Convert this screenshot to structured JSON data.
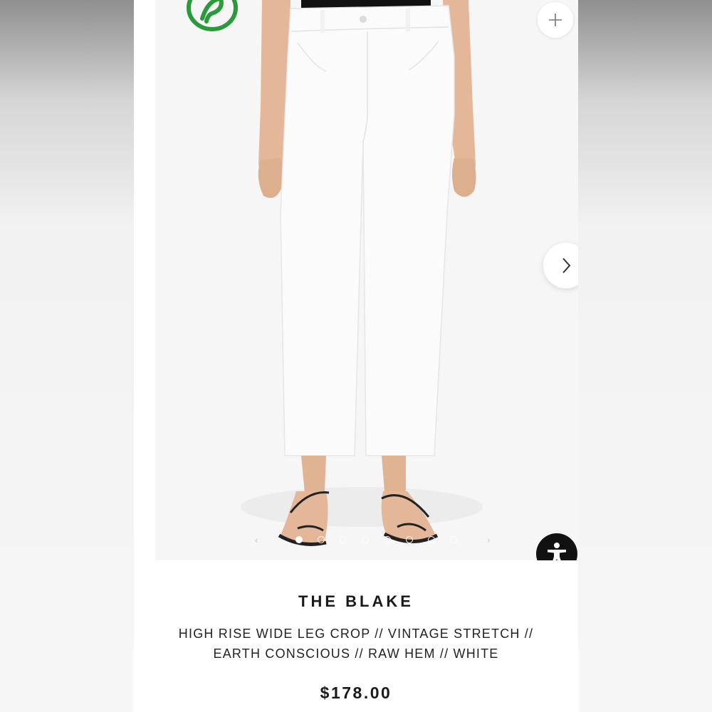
{
  "product": {
    "title": "THE BLAKE",
    "subtitle_line1": "HIGH RISE WIDE LEG CROP // VINTAGE STRETCH //",
    "subtitle_line2": "EARTH CONSCIOUS // RAW HEM // WHITE",
    "price": "$178.00"
  },
  "gallery": {
    "image_count": 8,
    "active_index": 0,
    "prev_arrow": "‹",
    "next_arrow": "›"
  },
  "icons": {
    "badge": "eco-leaf-icon",
    "add": "plus-icon",
    "next": "chevron-right-icon",
    "accessibility": "accessibility-icon"
  },
  "colors": {
    "badge_green": "#2a9a3a",
    "pants_white": "#fbfbfb",
    "accessibility_bg": "#111111"
  }
}
